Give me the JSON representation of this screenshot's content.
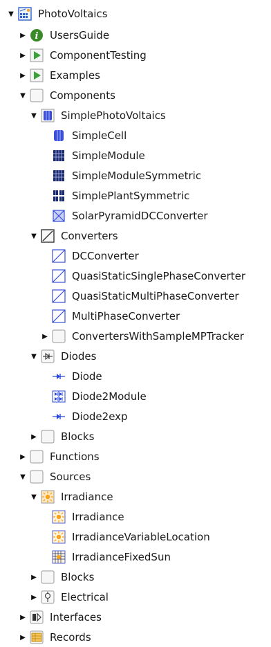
{
  "tree": {
    "root": "PhotoVoltaics",
    "users_guide": "UsersGuide",
    "component_testing": "ComponentTesting",
    "examples": "Examples",
    "components": "Components",
    "simple_pv": "SimplePhotoVoltaics",
    "simple_cell": "SimpleCell",
    "simple_module": "SimpleModule",
    "simple_module_sym": "SimpleModuleSymmetric",
    "simple_plant_sym": "SimplePlantSymmetric",
    "solar_pyramid": "SolarPyramidDCConverter",
    "converters": "Converters",
    "dc_converter": "DCConverter",
    "qs_single": "QuasiStaticSinglePhaseConverter",
    "qs_multi": "QuasiStaticMultiPhaseConverter",
    "multi_phase": "MultiPhaseConverter",
    "converters_mpt": "ConvertersWithSampleMPTracker",
    "diodes": "Diodes",
    "diode": "Diode",
    "diode2module": "Diode2Module",
    "diode2exp": "Diode2exp",
    "blocks1": "Blocks",
    "functions": "Functions",
    "sources": "Sources",
    "irradiance_pkg": "Irradiance",
    "irradiance": "Irradiance",
    "irradiance_var": "IrradianceVariableLocation",
    "irradiance_fixed": "IrradianceFixedSun",
    "blocks2": "Blocks",
    "electrical": "Electrical",
    "interfaces": "Interfaces",
    "records": "Records"
  },
  "arrows": {
    "expanded": "▼",
    "collapsed": "▶"
  },
  "colors": {
    "guide_green": "#3a8a2a",
    "play_green": "#3aa03a",
    "cell_blue": "#3a4fd8",
    "module_dark": "#1c2a6e",
    "diode_blue": "#2747d8",
    "sun_orange": "#f6a21a",
    "package_border": "#9a9a9a"
  }
}
